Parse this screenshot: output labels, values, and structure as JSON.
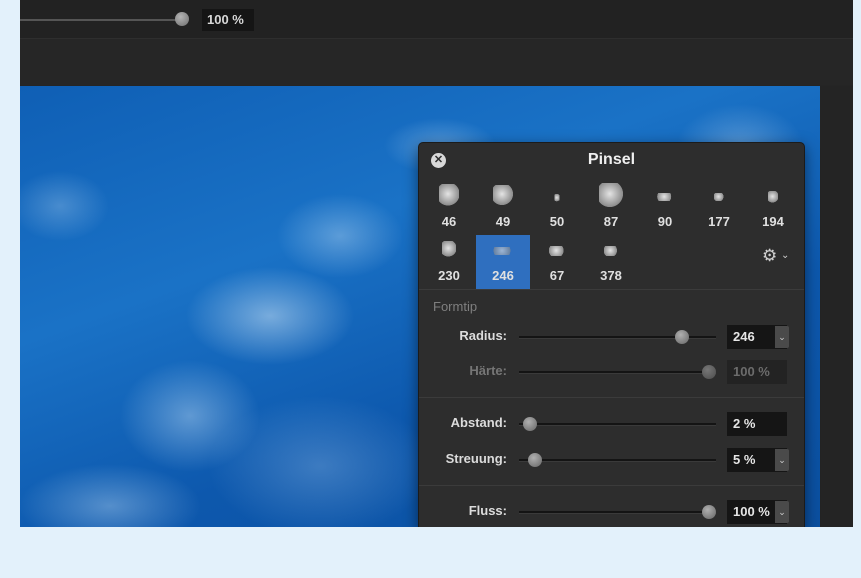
{
  "topbar": {
    "opacity_value": "100 %"
  },
  "panel": {
    "title": "Pinsel",
    "brushes": [
      {
        "label": "46"
      },
      {
        "label": "49"
      },
      {
        "label": "50"
      },
      {
        "label": "87"
      },
      {
        "label": "90"
      },
      {
        "label": "177"
      },
      {
        "label": "194"
      },
      {
        "label": "230"
      },
      {
        "label": "246",
        "selected": true
      },
      {
        "label": "67"
      },
      {
        "label": "378"
      }
    ],
    "section_label": "Formtip",
    "radius": {
      "label": "Radius:",
      "value": "246",
      "level": 0.85
    },
    "haerte": {
      "label": "Härte:",
      "value": "100 %",
      "level": 1.0,
      "disabled": true
    },
    "abstand": {
      "label": "Abstand:",
      "value": "2 %",
      "level": 0.02
    },
    "streuung": {
      "label": "Streuung:",
      "value": "5 %",
      "level": 0.05
    },
    "fluss": {
      "label": "Fluss:",
      "value": "100 %",
      "level": 1.0
    }
  },
  "icons": {
    "close": "close-icon",
    "gear": "gear-icon",
    "chevron": "chevron-down-icon"
  },
  "colors": {
    "selected": "#2f6fbf",
    "panel": "#2d2d2d",
    "canvas": "#1a72c6"
  }
}
